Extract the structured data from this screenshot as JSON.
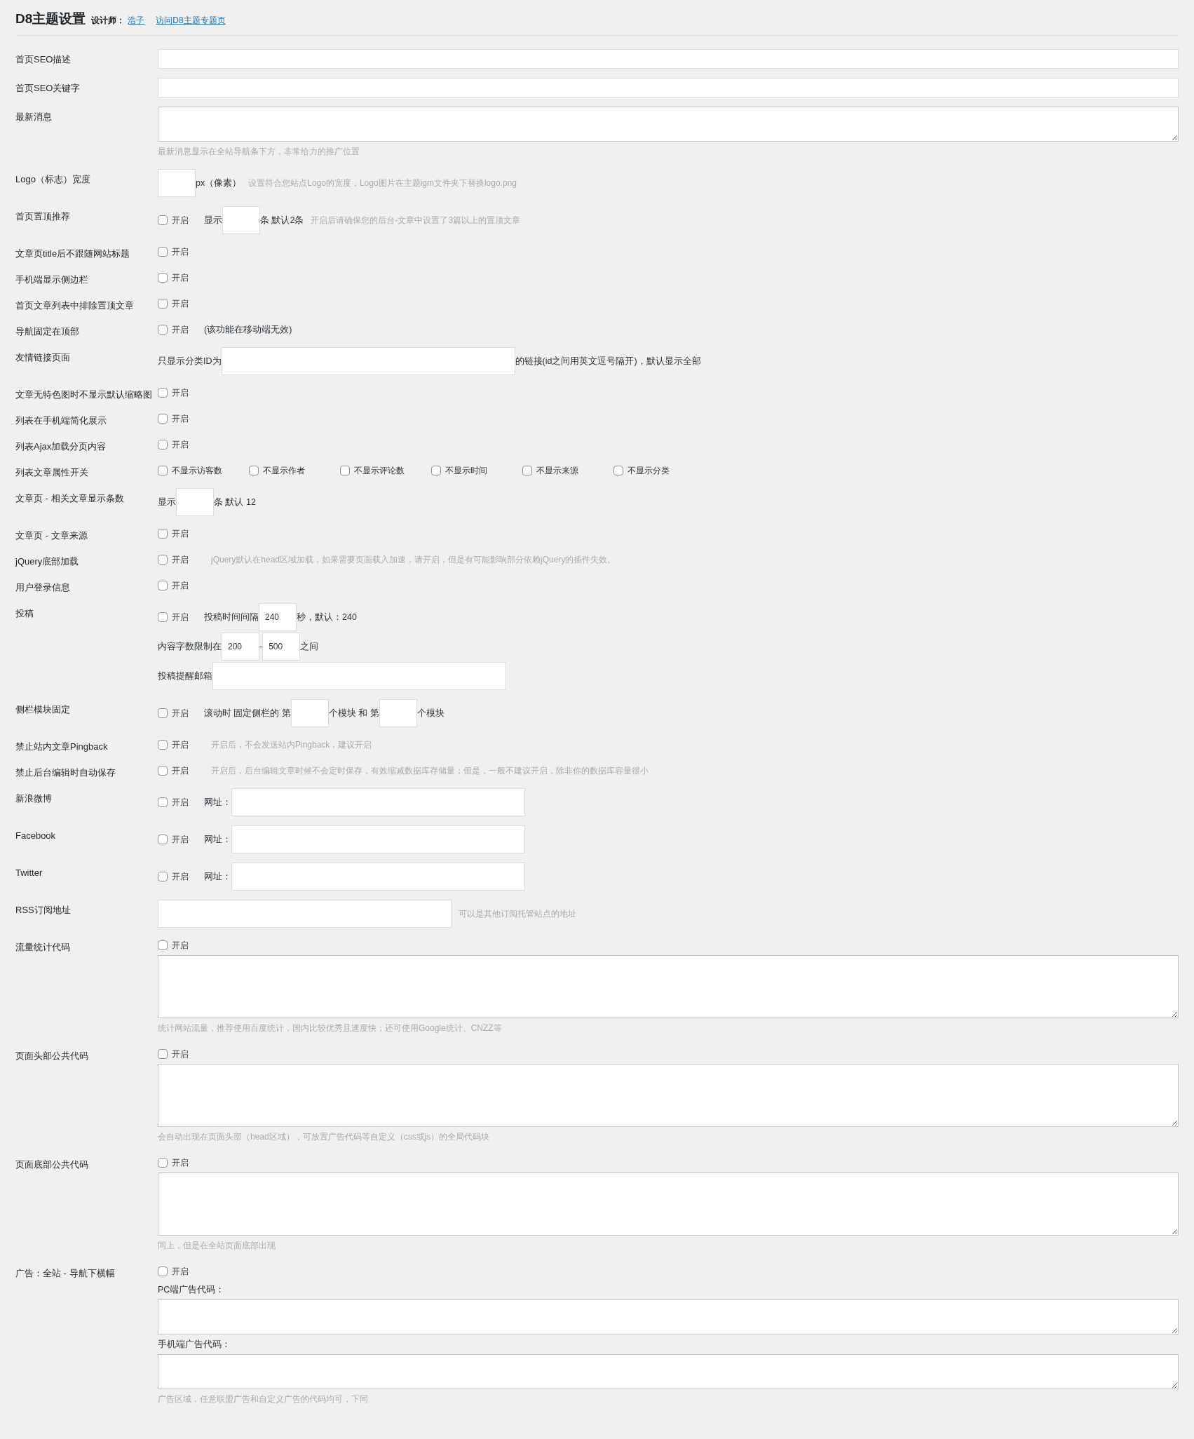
{
  "header": {
    "title": "D8主题设置",
    "designer_label": "设计师：",
    "links": [
      "浩子",
      "访问D8主题专题页"
    ]
  },
  "rows": [
    {
      "label": "首页SEO描述",
      "lines": [
        [
          {
            "kind": "input"
          }
        ]
      ]
    },
    {
      "label": "首页SEO关键字",
      "lines": [
        [
          {
            "kind": "input"
          }
        ]
      ]
    },
    {
      "label": "最新消息",
      "lines": [
        [
          {
            "kind": "textarea"
          }
        ],
        [
          {
            "kind": "hint",
            "text": "最新消息显示在全站导航条下方，非常给力的推广位置"
          }
        ]
      ]
    },
    {
      "label": "Logo（标志）宽度",
      "lines": [
        [
          {
            "kind": "short_input"
          },
          {
            "kind": "text",
            "text": "px（像素）"
          },
          {
            "kind": "hint",
            "text": "设置符合您站点Logo的宽度，Logo图片在主题igm文件夹下替换logo.png"
          }
        ]
      ]
    },
    {
      "label": "首页置顶推荐",
      "lines": [
        [
          {
            "kind": "checkbox",
            "label": "开启",
            "checked": false
          },
          {
            "kind": "text",
            "text": "显示"
          },
          {
            "kind": "short_input"
          },
          {
            "kind": "text",
            "text": "条 默认2条"
          },
          {
            "kind": "hint",
            "text": "开启后请确保您的后台-文章中设置了3篇以上的置顶文章"
          }
        ]
      ]
    },
    {
      "label": "文章页title后不跟随网站标题",
      "lines": [
        [
          {
            "kind": "checkbox",
            "label": "开启",
            "checked": false
          }
        ]
      ]
    },
    {
      "label": "手机端显示侧边栏",
      "lines": [
        [
          {
            "kind": "checkbox",
            "label": "开启",
            "checked": false
          }
        ]
      ]
    },
    {
      "label": "首页文章列表中排除置顶文章",
      "lines": [
        [
          {
            "kind": "checkbox",
            "label": "开启",
            "checked": false
          }
        ]
      ]
    },
    {
      "label": "导航固定在顶部",
      "lines": [
        [
          {
            "kind": "checkbox",
            "label": "开启",
            "checked": false
          },
          {
            "kind": "text",
            "text": "(该功能在移动端无效)"
          }
        ]
      ]
    },
    {
      "label": "友情链接页面",
      "lines": [
        [
          {
            "kind": "text",
            "text": "只显示分类ID为"
          },
          {
            "kind": "medium_input"
          },
          {
            "kind": "text",
            "text": "的链接(id之间用英文逗号隔开)，默认显示全部"
          }
        ]
      ]
    },
    {
      "label": "文章无特色图时不显示默认缩略图",
      "lines": [
        [
          {
            "kind": "checkbox",
            "label": "开启",
            "checked": false
          }
        ]
      ]
    },
    {
      "label": "列表在手机端简化展示",
      "lines": [
        [
          {
            "kind": "checkbox",
            "label": "开启",
            "checked": false
          }
        ]
      ]
    },
    {
      "label": "列表Ajax加载分页内容",
      "lines": [
        [
          {
            "kind": "checkbox",
            "label": "开启",
            "checked": false
          }
        ]
      ]
    },
    {
      "label": "列表文章属性开关",
      "lines": [
        [
          {
            "kind": "checkbox",
            "label": "不显示访客数",
            "checked": false
          },
          {
            "kind": "checkbox",
            "label": "不显示作者",
            "checked": false
          },
          {
            "kind": "checkbox",
            "label": "不显示评论数",
            "checked": false
          },
          {
            "kind": "checkbox",
            "label": "不显示时间",
            "checked": false
          },
          {
            "kind": "checkbox",
            "label": "不显示来源",
            "checked": false
          },
          {
            "kind": "checkbox",
            "label": "不显示分类",
            "checked": false
          }
        ]
      ]
    },
    {
      "label": "文章页 - 相关文章显示条数",
      "lines": [
        [
          {
            "kind": "text",
            "text": "显示"
          },
          {
            "kind": "short_input"
          },
          {
            "kind": "text",
            "text": "条 默认 12"
          }
        ]
      ]
    },
    {
      "label": "文章页 - 文章来源",
      "lines": [
        [
          {
            "kind": "checkbox",
            "label": "开启",
            "checked": false
          }
        ]
      ]
    },
    {
      "label": "jQuery底部加载",
      "lines": [
        [
          {
            "kind": "checkbox",
            "label": "开启",
            "checked": false
          },
          {
            "kind": "hint",
            "text": "jQuery默认在head区域加载，如果需要页面载入加速，请开启，但是有可能影响部分依赖jQuery的插件失效。"
          }
        ]
      ]
    },
    {
      "label": "用户登录信息",
      "lines": [
        [
          {
            "kind": "checkbox",
            "label": "开启",
            "checked": false
          }
        ]
      ]
    },
    {
      "label": "投稿",
      "lines": [
        [
          {
            "kind": "checkbox",
            "label": "开启",
            "checked": false
          },
          {
            "kind": "text",
            "text": "投稿时间间隔"
          },
          {
            "kind": "short_input",
            "value": "240"
          },
          {
            "kind": "text",
            "text": "秒，默认：240"
          }
        ],
        [
          {
            "kind": "text",
            "text": "内容字数限制在"
          },
          {
            "kind": "short_input",
            "value": "200"
          },
          {
            "kind": "text",
            "text": "-"
          },
          {
            "kind": "short_input",
            "value": "500"
          },
          {
            "kind": "text",
            "text": "之间"
          }
        ],
        [
          {
            "kind": "text",
            "text": "投稿提醒邮箱"
          },
          {
            "kind": "medium_input"
          }
        ]
      ]
    },
    {
      "label": "侧栏模块固定",
      "lines": [
        [
          {
            "kind": "checkbox",
            "label": "开启",
            "checked": false
          },
          {
            "kind": "text",
            "text": "滚动时 固定侧栏的 第"
          },
          {
            "kind": "short_input"
          },
          {
            "kind": "text",
            "text": "个模块 和 第"
          },
          {
            "kind": "short_input"
          },
          {
            "kind": "text",
            "text": "个模块"
          }
        ]
      ]
    },
    {
      "label": "禁止站内文章Pingback",
      "lines": [
        [
          {
            "kind": "checkbox",
            "label": "开启",
            "checked": false
          },
          {
            "kind": "hint",
            "text": "开启后，不会发送站内Pingback，建议开启"
          }
        ]
      ]
    },
    {
      "label": "禁止后台编辑时自动保存",
      "lines": [
        [
          {
            "kind": "checkbox",
            "label": "开启",
            "checked": false
          },
          {
            "kind": "hint",
            "text": "开启后，后台编辑文章时候不会定时保存，有效缩减数据库存储量；但是，一般不建议开启，除非你的数据库容量很小"
          }
        ]
      ]
    },
    {
      "label": "新浪微博",
      "lines": [
        [
          {
            "kind": "checkbox",
            "label": "开启",
            "checked": false
          },
          {
            "kind": "text",
            "text": "网址："
          },
          {
            "kind": "medium_input"
          }
        ]
      ]
    },
    {
      "label": "Facebook",
      "lines": [
        [
          {
            "kind": "checkbox",
            "label": "开启",
            "checked": false
          },
          {
            "kind": "text",
            "text": "网址："
          },
          {
            "kind": "medium_input"
          }
        ]
      ]
    },
    {
      "label": "Twitter",
      "lines": [
        [
          {
            "kind": "checkbox",
            "label": "开启",
            "checked": false
          },
          {
            "kind": "text",
            "text": "网址："
          },
          {
            "kind": "medium_input"
          }
        ]
      ]
    },
    {
      "label": "RSS订阅地址",
      "lines": [
        [
          {
            "kind": "medium_input"
          },
          {
            "kind": "hint",
            "text": "可以是其他订阅托管站点的地址"
          }
        ]
      ]
    },
    {
      "label": "流量统计代码",
      "lines": [
        [
          {
            "kind": "checkbox",
            "label": "开启",
            "checked": false
          }
        ],
        [
          {
            "kind": "large_textarea"
          }
        ],
        [
          {
            "kind": "hint",
            "text": "统计网站流量，推荐使用百度统计，国内比较优秀且速度快；还可使用Google统计、CNZZ等"
          }
        ]
      ]
    },
    {
      "label": "页面头部公共代码",
      "lines": [
        [
          {
            "kind": "checkbox",
            "label": "开启",
            "checked": false
          }
        ],
        [
          {
            "kind": "large_textarea"
          }
        ],
        [
          {
            "kind": "hint",
            "text": "会自动出现在页面头部（head区域），可放置广告代码等自定义（css或js）的全局代码块"
          }
        ]
      ]
    },
    {
      "label": "页面底部公共代码",
      "lines": [
        [
          {
            "kind": "checkbox",
            "label": "开启",
            "checked": false
          }
        ],
        [
          {
            "kind": "large_textarea"
          }
        ],
        [
          {
            "kind": "hint",
            "text": "同上，但是在全站页面底部出现"
          }
        ]
      ]
    },
    {
      "label": "广告：全站 - 导航下横幅",
      "lines": [
        [
          {
            "kind": "checkbox",
            "label": "开启",
            "checked": false
          }
        ],
        [
          {
            "kind": "text",
            "text": "PC端广告代码："
          }
        ],
        [
          {
            "kind": "textarea"
          }
        ],
        [
          {
            "kind": "text",
            "text": "手机端广告代码："
          }
        ],
        [
          {
            "kind": "textarea"
          }
        ],
        [
          {
            "kind": "hint",
            "text": "广告区域，任意联盟广告和自定义广告的代码均可，下同"
          }
        ]
      ]
    }
  ]
}
